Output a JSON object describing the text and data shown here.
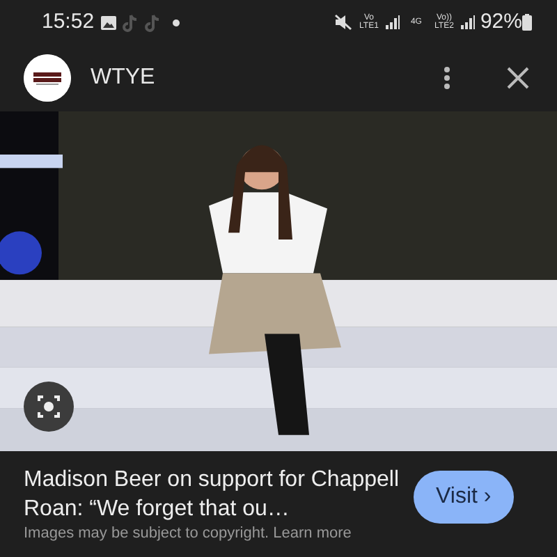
{
  "status_bar": {
    "time": "15:52",
    "network": [
      "Vo LTE1",
      "4G",
      "Vo)) LTE2"
    ],
    "battery": "92%"
  },
  "header": {
    "title": "WTYE"
  },
  "result": {
    "title": "Madison Beer on support for Chappell Roan: “We forget that ou…",
    "button": "Visit",
    "caret": "›",
    "notice": "Images may be subject to copyright. Learn more"
  }
}
